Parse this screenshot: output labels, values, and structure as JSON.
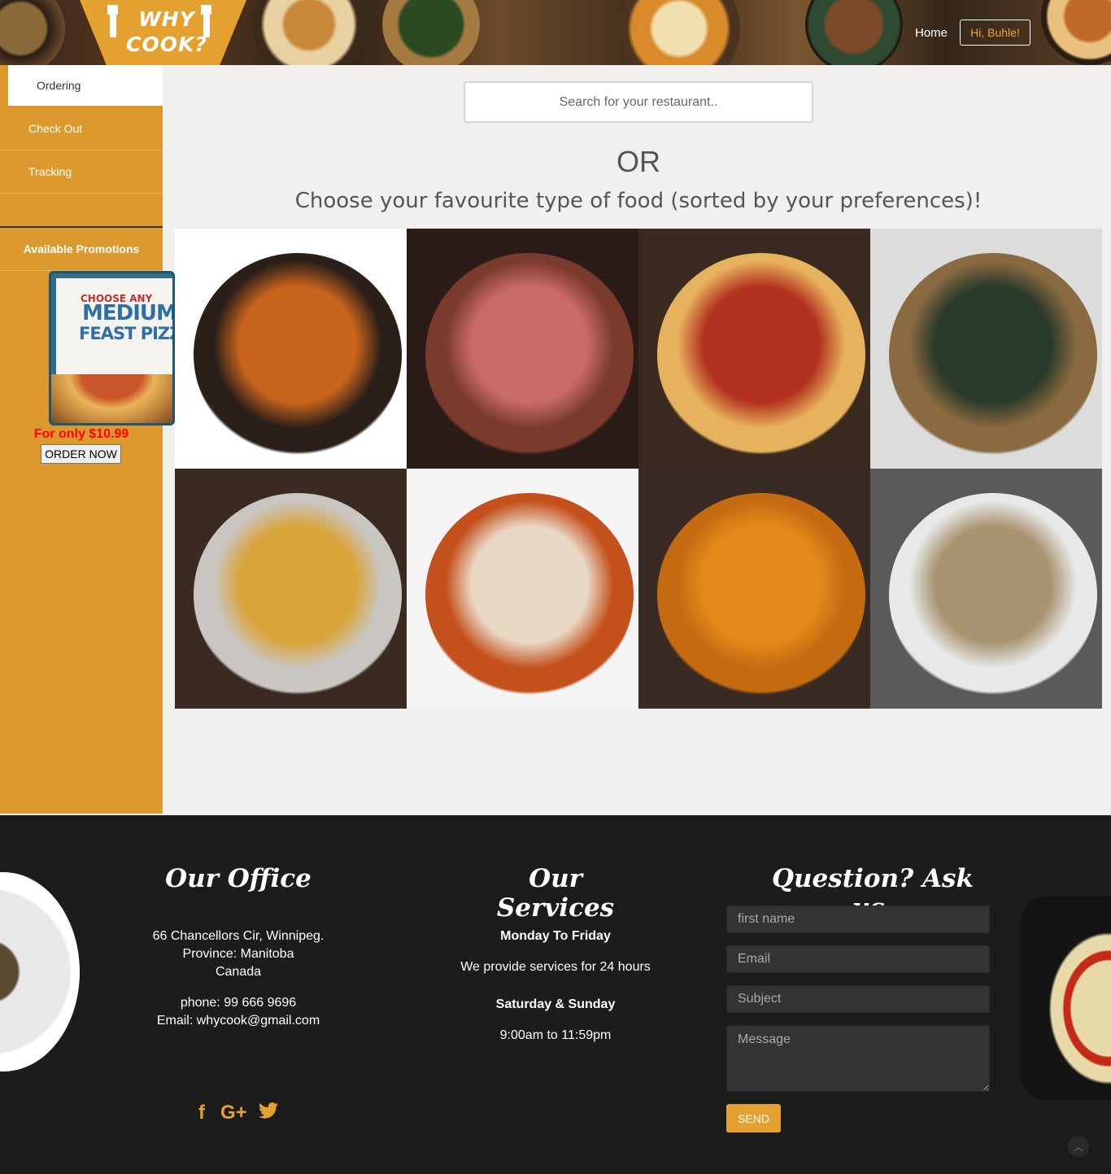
{
  "header": {
    "logo_line1": "WHY",
    "logo_line2": "COOK?",
    "nav_home": "Home",
    "nav_user": "Hi, Buhle!"
  },
  "sidebar": {
    "items": [
      {
        "label": "Ordering",
        "active": true
      },
      {
        "label": "Check Out",
        "active": false
      },
      {
        "label": "Tracking",
        "active": false
      }
    ],
    "promotions_title": "Available Promotions",
    "promo_image_text": {
      "line1": "CHOOSE ANY",
      "line2": "MEDIUM",
      "line3": "FEAST PIZZA"
    },
    "promo_price": "For only $10.99",
    "order_button": "ORDER NOW"
  },
  "main": {
    "search_placeholder": "Search for your restaurant..",
    "or_text": "OR",
    "choose_text": "Choose your favourite type of food (sorted by your preferences)!",
    "food_tiles": [
      {
        "name": "chinese-chicken",
        "colors": [
          "#ffffff",
          "#2b1f1a",
          "#c9641c"
        ]
      },
      {
        "name": "steak",
        "colors": [
          "#2c1c18",
          "#7a3a2c",
          "#c96a68"
        ]
      },
      {
        "name": "pepperoni-pizza",
        "colors": [
          "#3a2a20",
          "#e7b25d",
          "#b2321f"
        ]
      },
      {
        "name": "sushi",
        "colors": [
          "#dcdcdc",
          "#8a6a40",
          "#2a3a2a"
        ]
      },
      {
        "name": "indian-thali",
        "colors": [
          "#3a2a22",
          "#c9c6c2",
          "#d9a43a"
        ]
      },
      {
        "name": "lobster",
        "colors": [
          "#f4f4f4",
          "#c4501c",
          "#e9d8c4"
        ]
      },
      {
        "name": "curry",
        "colors": [
          "#3a2a24",
          "#c46b12",
          "#e58a1a"
        ]
      },
      {
        "name": "pho",
        "colors": [
          "#5a5a5a",
          "#e8e8e8",
          "#a89470"
        ]
      }
    ]
  },
  "footer": {
    "office": {
      "title": "Our Office",
      "address1": "66 Chancellors Cir, Winnipeg.",
      "address2": "Province: Manitoba",
      "address3": "Canada",
      "phone": "phone: 99 666 9696",
      "email": "Email: whycook@gmail.com"
    },
    "services": {
      "title": "Our Services",
      "weekday_label": "Monday To Friday",
      "weekday_text": "We provide services for 24 hours",
      "weekend_label": "Saturday & Sunday",
      "weekend_text": "9:00am to 11:59pm"
    },
    "contact": {
      "title": "Question? Ask us.",
      "first_name_placeholder": "first name",
      "email_placeholder": "Email",
      "subject_placeholder": "Subject",
      "message_placeholder": "Message",
      "send_label": "SEND"
    },
    "social": {
      "facebook": "f",
      "google": "G+",
      "twitter": "🐦"
    },
    "back_to_top": "︿"
  },
  "colors": {
    "accent": "#e5a130",
    "sidebar": "#dc9a2e",
    "footer_bg": "#1c1c1c",
    "promo_price": "#ff0000"
  }
}
